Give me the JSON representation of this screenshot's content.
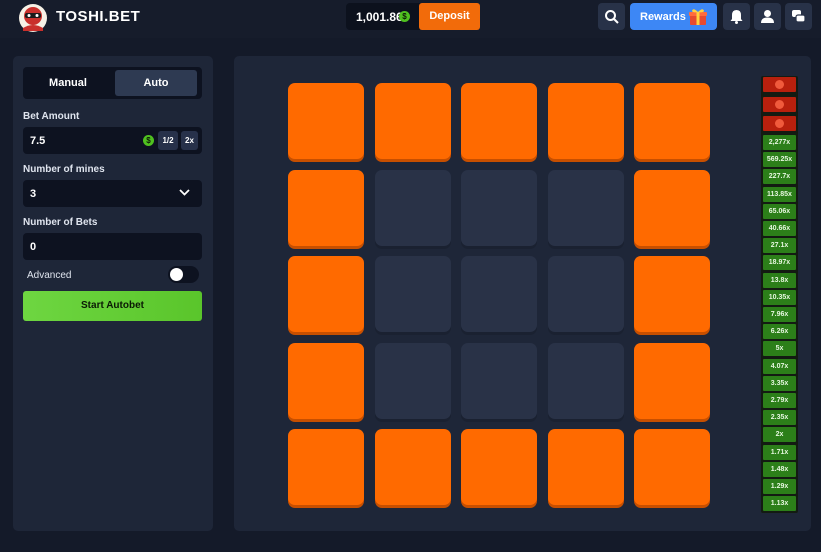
{
  "header": {
    "brand": "TOSHI.BET",
    "balance": "1,001.86",
    "currency_symbol": "$",
    "deposit_label": "Deposit",
    "rewards_label": "Rewards",
    "accent_orange": "#f26b0a",
    "rewards_blue": "#3d87f5",
    "icons": [
      "search-icon",
      "gift-icon",
      "bell-icon",
      "user-icon",
      "chat-icon"
    ]
  },
  "panel": {
    "tabs": [
      {
        "label": "Manual",
        "active": false
      },
      {
        "label": "Auto",
        "active": true
      }
    ],
    "bet_amount_label": "Bet Amount",
    "bet_amount_value": "7.5",
    "half_label": "1/2",
    "double_label": "2x",
    "mines_label": "Number of mines",
    "mines_value": "3",
    "bets_label": "Number of Bets",
    "bets_value": "0",
    "advanced_label": "Advanced",
    "advanced_on": false,
    "start_label": "Start Autobet",
    "start_color": "#5ac52b"
  },
  "board": {
    "rows": [
      [
        "open",
        "open",
        "open",
        "open",
        "open"
      ],
      [
        "open",
        "closed",
        "closed",
        "closed",
        "open"
      ],
      [
        "open",
        "closed",
        "closed",
        "closed",
        "open"
      ],
      [
        "open",
        "closed",
        "closed",
        "closed",
        "open"
      ],
      [
        "open",
        "open",
        "open",
        "open",
        "open"
      ]
    ],
    "open_color": "#ff6a00",
    "closed_color": "#293247"
  },
  "multipliers": {
    "mines": 3,
    "values": [
      "2,277x",
      "569.25x",
      "227.7x",
      "113.85x",
      "65.06x",
      "40.66x",
      "27.1x",
      "18.97x",
      "13.8x",
      "10.35x",
      "7.96x",
      "6.26x",
      "5x",
      "4.07x",
      "3.35x",
      "2.79x",
      "2.35x",
      "2x",
      "1.71x",
      "1.48x",
      "1.29x",
      "1.13x"
    ]
  }
}
